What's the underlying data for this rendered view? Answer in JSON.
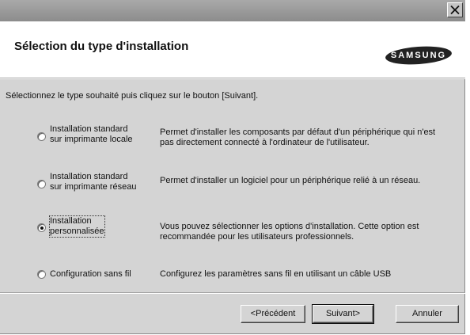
{
  "header": {
    "title": "Sélection du type d'installation",
    "logo_text": "SAMSUNG"
  },
  "instruction": "Sélectionnez le type souhaité puis cliquez sur le bouton [Suivant].",
  "options": [
    {
      "label_line1": "Installation standard",
      "label_line2": "sur imprimante locale",
      "desc_line1": "Permet d'installer les composants par défaut d'un périphérique qui n'est",
      "desc_line2": "pas directement connecté à l'ordinateur de l'utilisateur.",
      "selected": false
    },
    {
      "label_line1": "Installation standard",
      "label_line2": "sur imprimante réseau",
      "desc_line1": "Permet d'installer un logiciel pour un périphérique relié à un réseau.",
      "desc_line2": "",
      "selected": false
    },
    {
      "label_line1": "Installation",
      "label_line2": "personnalisée",
      "desc_line1": "Vous pouvez sélectionner les options d'installation. Cette option est",
      "desc_line2": "recommandée pour les utilisateurs professionnels.",
      "selected": true
    },
    {
      "label_line1": "Configuration sans fil",
      "label_line2": "",
      "desc_line1": "Configurez les paramètres sans fil en utilisant un câble USB",
      "desc_line2": "",
      "selected": false
    }
  ],
  "buttons": {
    "back": "<Précédent",
    "next": "Suivant>",
    "cancel": "Annuler"
  },
  "colors": {
    "dialog_bg": "#d4d4d4",
    "header_bg": "#ffffff",
    "titlebar": "#8c8c8c",
    "logo_bg": "#222222"
  },
  "icons": {
    "close": "close-icon",
    "logo": "samsung-logo"
  }
}
